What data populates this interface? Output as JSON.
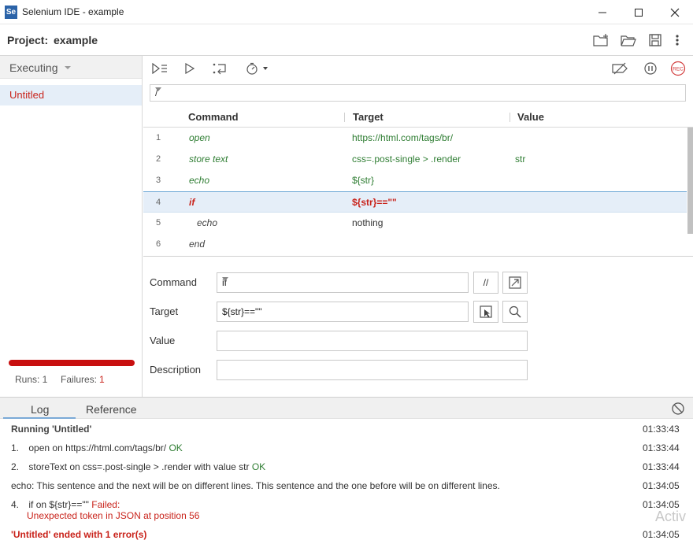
{
  "window": {
    "icon_text": "Se",
    "title": "Selenium IDE - example"
  },
  "project": {
    "label": "Project:",
    "name": "example"
  },
  "sidebar": {
    "mode": "Executing",
    "tests": [
      {
        "label": "Untitled"
      }
    ],
    "runs_label": "Runs: 1",
    "failures_label": "Failures:",
    "failures_count": "1"
  },
  "url": {
    "value": "/"
  },
  "table": {
    "columns": [
      "Command",
      "Target",
      "Value"
    ],
    "rows": [
      {
        "num": "1",
        "command": "open",
        "target": "https://html.com/tags/br/",
        "value": "",
        "state": "passed"
      },
      {
        "num": "2",
        "command": "store text",
        "target": "css=.post-single > .render",
        "value": "str",
        "state": "passed"
      },
      {
        "num": "3",
        "command": "echo",
        "target": "${str}",
        "value": "",
        "state": "passed"
      },
      {
        "num": "4",
        "command": "if",
        "target": "${str}==\"\"",
        "value": "",
        "state": "failed"
      },
      {
        "num": "5",
        "command": "echo",
        "target": "nothing",
        "value": "",
        "state": "pending"
      },
      {
        "num": "6",
        "command": "end",
        "target": "",
        "value": "",
        "state": "pending"
      }
    ]
  },
  "editor": {
    "command_label": "Command",
    "command_value": "if",
    "comment_button": "//",
    "target_label": "Target",
    "target_value": "${str}==\"\"",
    "value_label": "Value",
    "value_value": "",
    "description_label": "Description",
    "description_value": ""
  },
  "log": {
    "tabs": [
      "Log",
      "Reference"
    ],
    "entries": [
      {
        "text": "Running 'Untitled'",
        "time": "01:33:43"
      },
      {
        "prefix": "1.",
        "text": "open on https://html.com/tags/br/",
        "status": "OK",
        "time": "01:33:44"
      },
      {
        "prefix": "2.",
        "text": "storeText on css=.post-single > .render with value str",
        "status": "OK",
        "time": "01:33:44"
      },
      {
        "text": "echo: This sentence and the next will be on different lines. This sentence and the one before will be on different lines.",
        "time": "01:34:05"
      },
      {
        "prefix": "4.",
        "text": "if on ${str}==\"\"",
        "status": "Failed:",
        "detail": "Unexpected token in JSON at position 56",
        "time": "01:34:05"
      },
      {
        "text": "'Untitled' ended with 1 error(s)",
        "time": "01:34:05"
      }
    ]
  },
  "watermark": "Activ",
  "colors": {
    "accent_red": "#c80f0f",
    "ok_green": "#2e7d32",
    "selected_row": "#e5eef8",
    "brand_blue": "#2b63a8"
  }
}
